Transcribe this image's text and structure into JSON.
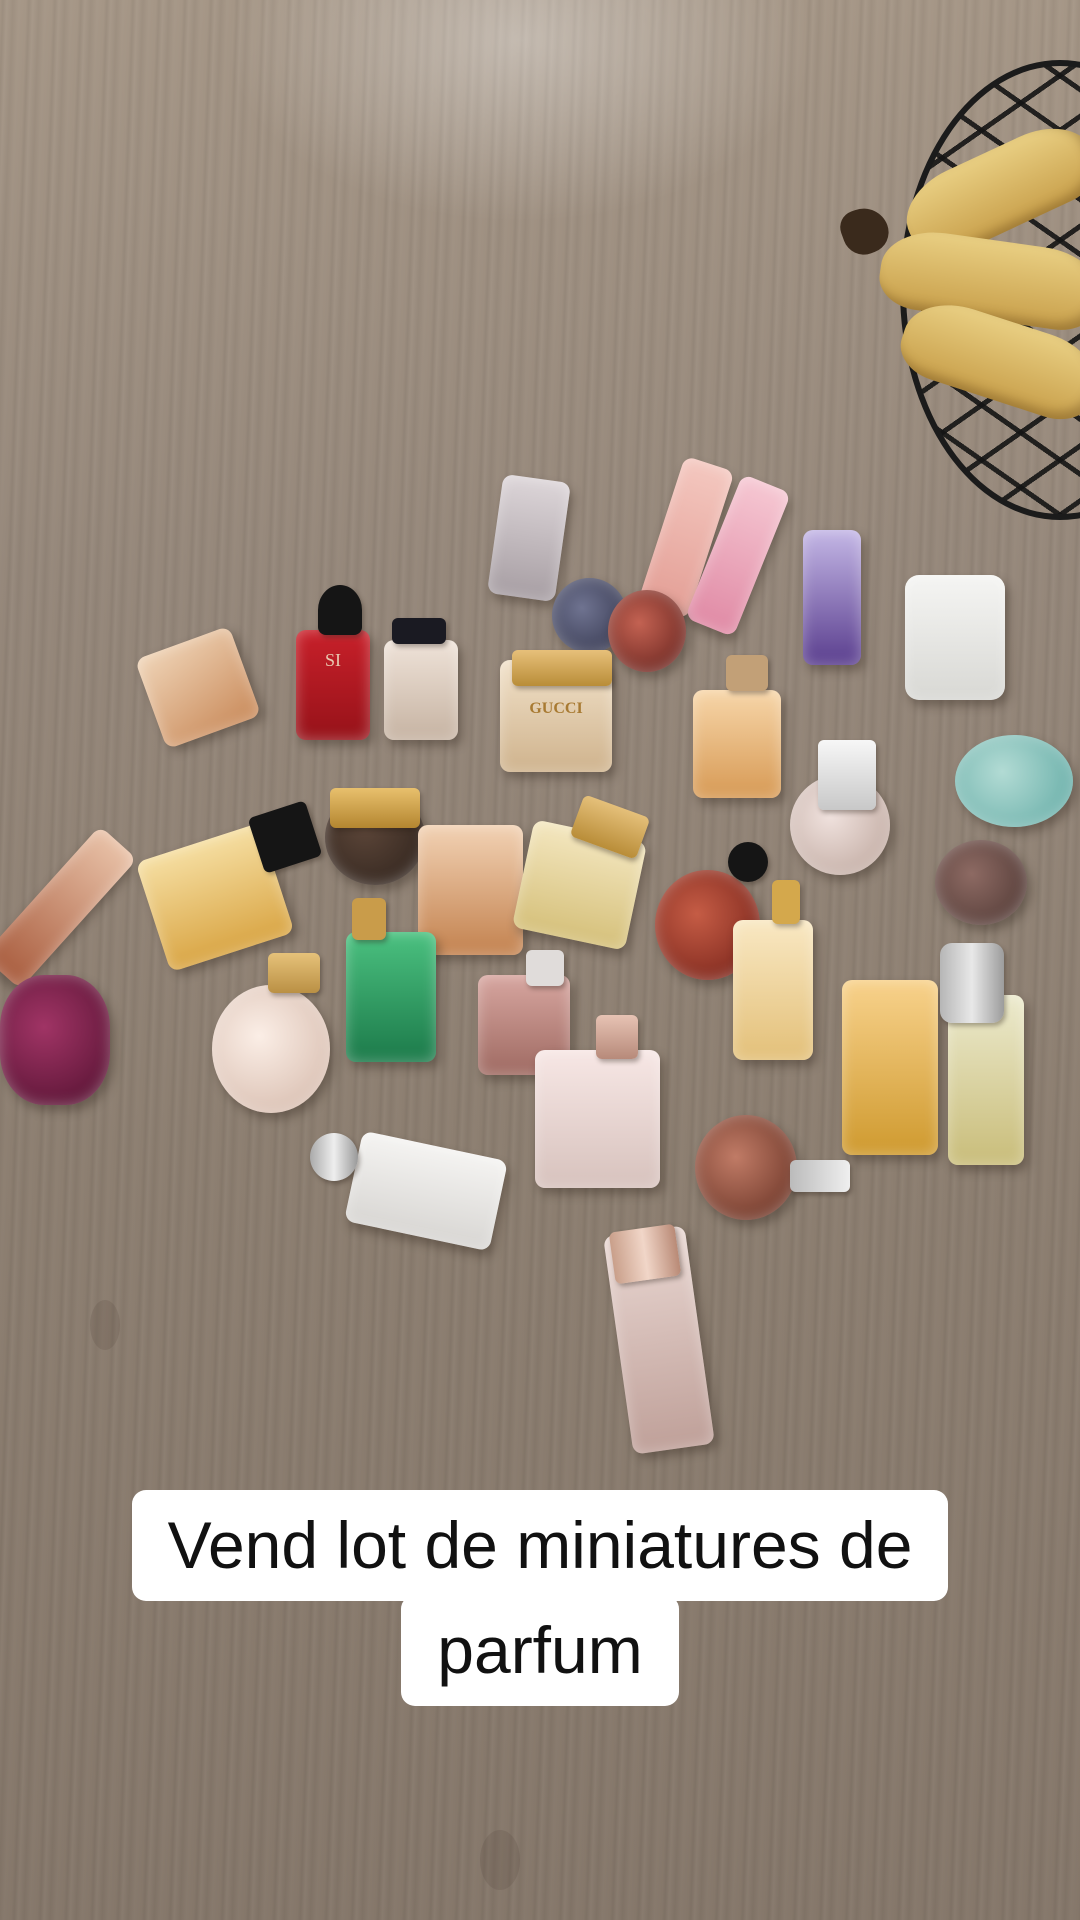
{
  "caption": {
    "line1": "Vend lot de miniatures de",
    "line2": "parfum"
  },
  "bottle_labels": {
    "si": "SI",
    "gucci": "GUCCI"
  },
  "colors": {
    "caption_bg": "#ffffff",
    "caption_text": "#111111"
  }
}
